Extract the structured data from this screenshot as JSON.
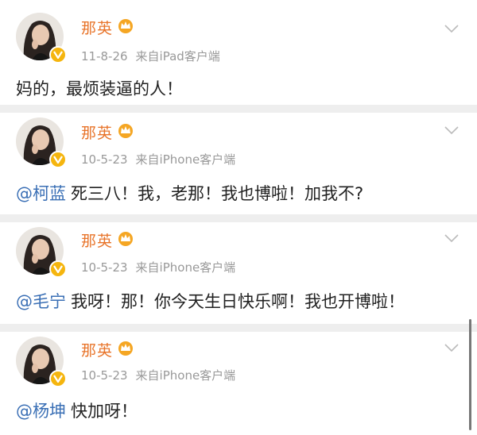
{
  "posts": [
    {
      "author": "那英",
      "date": "11-8-26",
      "source": "来自iPad客户端",
      "mention": "",
      "text": "妈的，最烦装逼的人！"
    },
    {
      "author": "那英",
      "date": "10-5-23",
      "source": "来自iPhone客户端",
      "mention": "@柯蓝",
      "text": "死三八！我，老那！我也博啦！加我不?"
    },
    {
      "author": "那英",
      "date": "10-5-23",
      "source": "来自iPhone客户端",
      "mention": "@毛宁",
      "text": "我呀！那！你今天生日快乐啊！我也开博啦！"
    },
    {
      "author": "那英",
      "date": "10-5-23",
      "source": "来自iPhone客户端",
      "mention": "@杨坤",
      "text": "快加呀！"
    }
  ],
  "icons": {
    "verified": "verified-v-icon",
    "crown": "crown-icon",
    "menu": "chevron-down-icon"
  },
  "colors": {
    "username": "#e8742a",
    "mention": "#3a6fb5",
    "meta": "#999999",
    "verified_badge": "#f5b50e"
  }
}
